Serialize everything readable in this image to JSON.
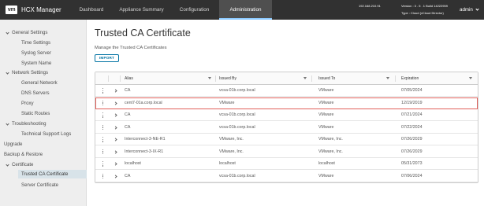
{
  "header": {
    "logo": "vm",
    "title": "HCX Manager",
    "tabs": [
      {
        "label": "Dashboard",
        "active": false
      },
      {
        "label": "Appliance Summary",
        "active": false
      },
      {
        "label": "Configuration",
        "active": false
      },
      {
        "label": "Administration",
        "active": true
      }
    ],
    "ip": "192.168.210.91",
    "version": "Version : 3 . 5 . 1 Build 14222959",
    "type": "Type : Cloud (vCloud Director)",
    "user": "admin"
  },
  "sidebar": {
    "groups": [
      {
        "label": "General Settings",
        "items": [
          "Time Settings",
          "Syslog Server",
          "System Name"
        ]
      },
      {
        "label": "Network Settings",
        "items": [
          "General Network",
          "DNS Servers",
          "Proxy",
          "Static Routes"
        ]
      },
      {
        "label": "Troubleshooting",
        "items": [
          "Technical Support Logs"
        ]
      },
      {
        "label": "Upgrade",
        "items": []
      },
      {
        "label": "Backup & Restore",
        "items": []
      },
      {
        "label": "Certificate",
        "items": [
          "Trusted CA Certificate",
          "Server Certificate"
        ]
      }
    ],
    "selected": "Trusted CA Certificate"
  },
  "main": {
    "title": "Trusted CA Certificate",
    "description": "Manage the Trusted CA Certificates",
    "import_label": "IMPORT",
    "columns": [
      "Alias",
      "Issued By",
      "Issued To",
      "Expiration"
    ],
    "rows": [
      {
        "alias": "CA",
        "issued_by": "vcsa-01b.corp.local",
        "issued_to": "VMware",
        "expiration": "07/05/2024"
      },
      {
        "alias": "cent7-01a.corp.local",
        "issued_by": "VMware",
        "issued_to": "VMware",
        "expiration": "12/19/2019",
        "highlighted": true
      },
      {
        "alias": "CA",
        "issued_by": "vcsa-01b.corp.local",
        "issued_to": "VMware",
        "expiration": "07/21/2024"
      },
      {
        "alias": "CA",
        "issued_by": "vcsa-01b.corp.local",
        "issued_to": "VMware",
        "expiration": "07/22/2024"
      },
      {
        "alias": "Interconnect-3-NE-R1",
        "issued_by": "VMware, Inc.",
        "issued_to": "VMware, Inc.",
        "expiration": "07/26/2029"
      },
      {
        "alias": "Interconnect-3-IX-R1",
        "issued_by": "VMware, Inc.",
        "issued_to": "VMware, Inc.",
        "expiration": "07/26/2029"
      },
      {
        "alias": "localhost",
        "issued_by": "localhost",
        "issued_to": "localhost",
        "expiration": "05/31/2073"
      },
      {
        "alias": "CA",
        "issued_by": "vcsa-01b.corp.local",
        "issued_to": "VMware",
        "expiration": "07/06/2024"
      }
    ]
  },
  "colors": {
    "header_bg": "#313131",
    "active_tab_bg": "#4f4f4f",
    "accent": "#0072a3",
    "highlight_border": "#e0605a",
    "sidebar_bg": "#eeeeee",
    "sidebar_selected_bg": "#d8e3e9"
  },
  "icons": {
    "filter": "filter-icon",
    "row_menu": "kebab-icon",
    "row_expand": "chevron-right-icon",
    "group_toggle": "chevron-down-icon",
    "user_menu": "chevron-down-icon"
  }
}
